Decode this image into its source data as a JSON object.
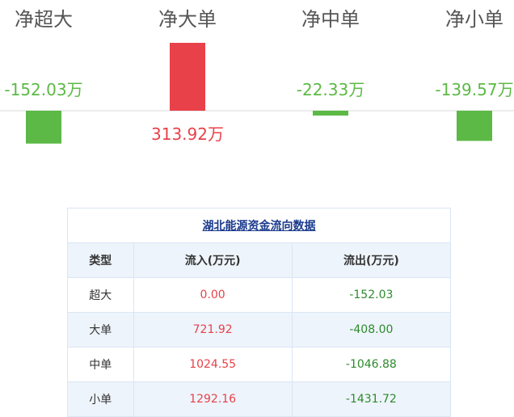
{
  "chart_data": {
    "type": "bar",
    "categories": [
      "净超大",
      "净大单",
      "净中单",
      "净小单"
    ],
    "values": [
      -152.03,
      313.92,
      -22.33,
      -139.57
    ],
    "value_labels": [
      "-152.03万",
      "313.92万",
      "-22.33万",
      "-139.57万"
    ],
    "unit": "万",
    "colors": {
      "positive": "#e8414a",
      "negative": "#5cb946"
    },
    "grid": false
  },
  "table": {
    "title": "湖北能源资金流向数据",
    "headers": [
      "类型",
      "流入(万元)",
      "流出(万元)"
    ],
    "rows": [
      {
        "type": "超大",
        "inflow": "0.00",
        "outflow": "-152.03"
      },
      {
        "type": "大单",
        "inflow": "721.92",
        "outflow": "-408.00"
      },
      {
        "type": "中单",
        "inflow": "1024.55",
        "outflow": "-1046.88"
      },
      {
        "type": "小单",
        "inflow": "1292.16",
        "outflow": "-1431.72"
      }
    ]
  }
}
